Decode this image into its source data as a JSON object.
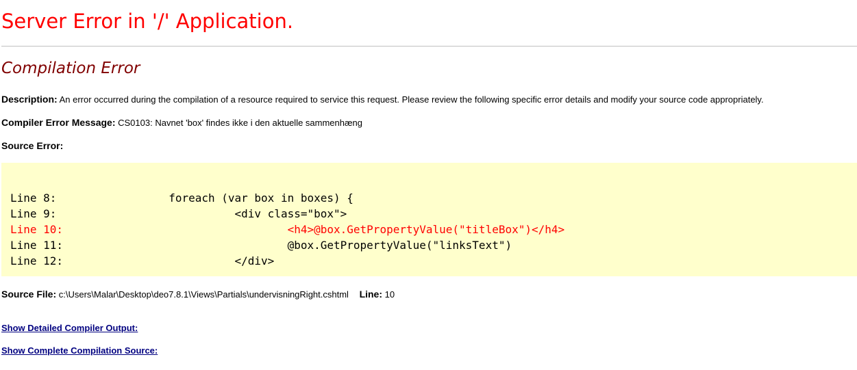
{
  "header": {
    "title": "Server Error in '/' Application.",
    "subtitle": "Compilation Error"
  },
  "description": {
    "label": "Description:",
    "text": "An error occurred during the compilation of a resource required to service this request. Please review the following specific error details and modify your source code appropriately."
  },
  "compiler_error": {
    "label": "Compiler Error Message:",
    "text": "CS0103: Navnet 'box' findes ikke i den aktuelle sammenhæng"
  },
  "source_error": {
    "label": "Source Error:"
  },
  "code_lines": [
    {
      "text": "Line 8:                 foreach (var box in boxes) {",
      "highlight": false
    },
    {
      "text": "Line 9:                           <div class=\"box\">",
      "highlight": false
    },
    {
      "text": "Line 10:                                  <h4>@box.GetPropertyValue(\"titleBox\")</h4>",
      "highlight": true
    },
    {
      "text": "Line 11:                                  @box.GetPropertyValue(\"linksText\")",
      "highlight": false
    },
    {
      "text": "Line 12:                          </div>",
      "highlight": false
    }
  ],
  "source_file": {
    "label": "Source File:",
    "path": "c:\\Users\\Malar\\Desktop\\deo7.8.1\\Views\\Partials\\undervisningRight.cshtml",
    "line_label": "Line:",
    "line_value": "10"
  },
  "links": {
    "detailed_output": "Show Detailed Compiler Output:",
    "complete_source": "Show Complete Compilation Source:"
  },
  "colors": {
    "title": "#ff0000",
    "subtitle": "#800000",
    "code_background": "#ffffcc",
    "error_line": "#ff0000",
    "link": "#000080"
  }
}
